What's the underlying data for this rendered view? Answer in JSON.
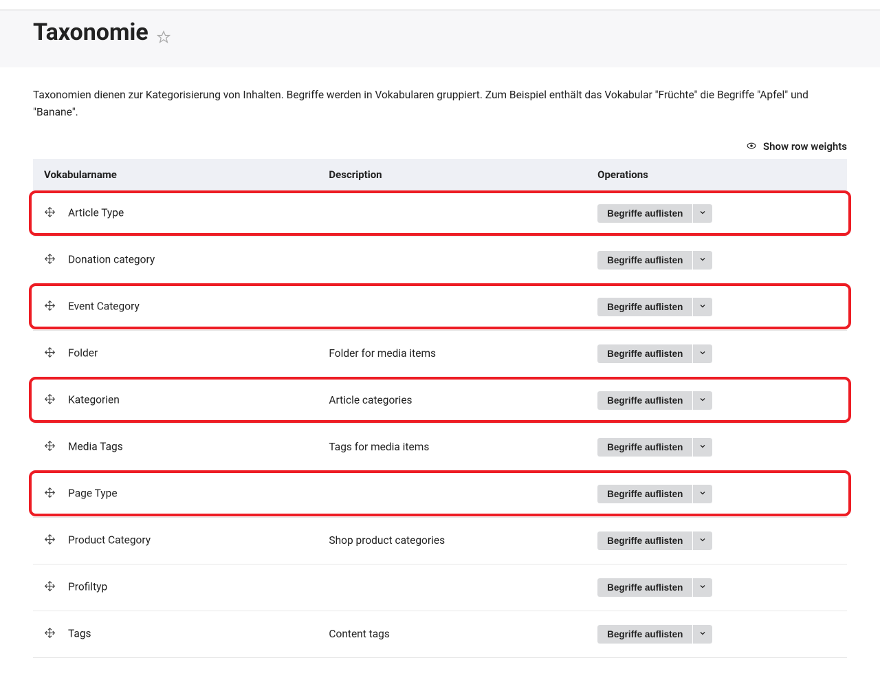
{
  "pageTitle": "Taxonomie",
  "intro": "Taxonomien dienen zur Kategorisierung von Inhalten. Begriffe werden in Vokabularen gruppiert. Zum Beispiel enthält das Vokabular \"Früchte\" die Begriffe \"Apfel\" und \"Banane\".",
  "showRowWeights": "Show row weights",
  "columns": {
    "name": "Vokabularname",
    "description": "Description",
    "operations": "Operations"
  },
  "buttons": {
    "list": "Begriffe auflisten"
  },
  "rows": [
    {
      "name": "Article Type",
      "description": "",
      "highlight": true
    },
    {
      "name": "Donation category",
      "description": "",
      "highlight": false
    },
    {
      "name": "Event Category",
      "description": "",
      "highlight": true
    },
    {
      "name": "Folder",
      "description": "Folder for media items",
      "highlight": false
    },
    {
      "name": "Kategorien",
      "description": "Article categories",
      "highlight": true
    },
    {
      "name": "Media Tags",
      "description": "Tags for media items",
      "highlight": false
    },
    {
      "name": "Page Type",
      "description": "",
      "highlight": true
    },
    {
      "name": "Product Category",
      "description": "Shop product categories",
      "highlight": false
    },
    {
      "name": "Profiltyp",
      "description": "",
      "highlight": false
    },
    {
      "name": "Tags",
      "description": "Content tags",
      "highlight": false
    }
  ]
}
